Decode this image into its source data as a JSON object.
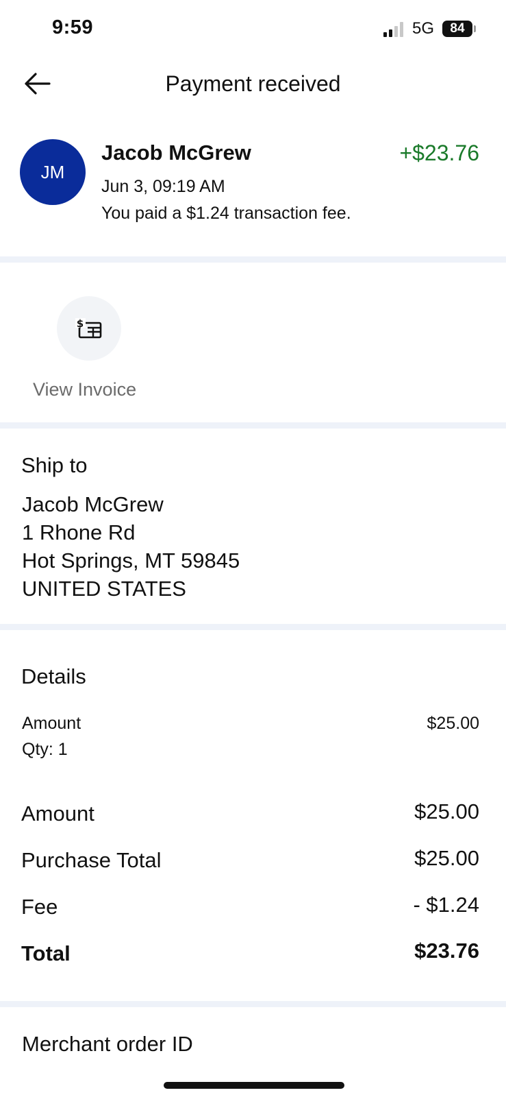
{
  "status_bar": {
    "time": "9:59",
    "network": "5G",
    "battery": "84"
  },
  "header": {
    "title": "Payment received"
  },
  "payer": {
    "initials": "JM",
    "name": "Jacob McGrew",
    "amount": "+$23.76",
    "date": "Jun 3, 09:19 AM",
    "fee_note": "You paid a $1.24 transaction fee."
  },
  "invoice": {
    "label": "View Invoice"
  },
  "ship_to": {
    "title": "Ship to",
    "lines": [
      "Jacob McGrew",
      "1 Rhone Rd",
      "Hot Springs, MT 59845",
      "UNITED STATES"
    ]
  },
  "details": {
    "title": "Details",
    "item": {
      "label": "Amount",
      "qty": "Qty: 1",
      "value": "$25.00"
    },
    "rows": [
      {
        "label": "Amount",
        "value": "$25.00"
      },
      {
        "label": "Purchase Total",
        "value": "$25.00"
      },
      {
        "label": "Fee",
        "value": "- $1.24"
      },
      {
        "label": "Total",
        "value": "$23.76"
      }
    ]
  },
  "merchant": {
    "title": "Merchant order ID"
  },
  "colors": {
    "avatar": "#0a2c9a",
    "positive_amount": "#1a7a2a",
    "divider": "#eef2f9"
  }
}
